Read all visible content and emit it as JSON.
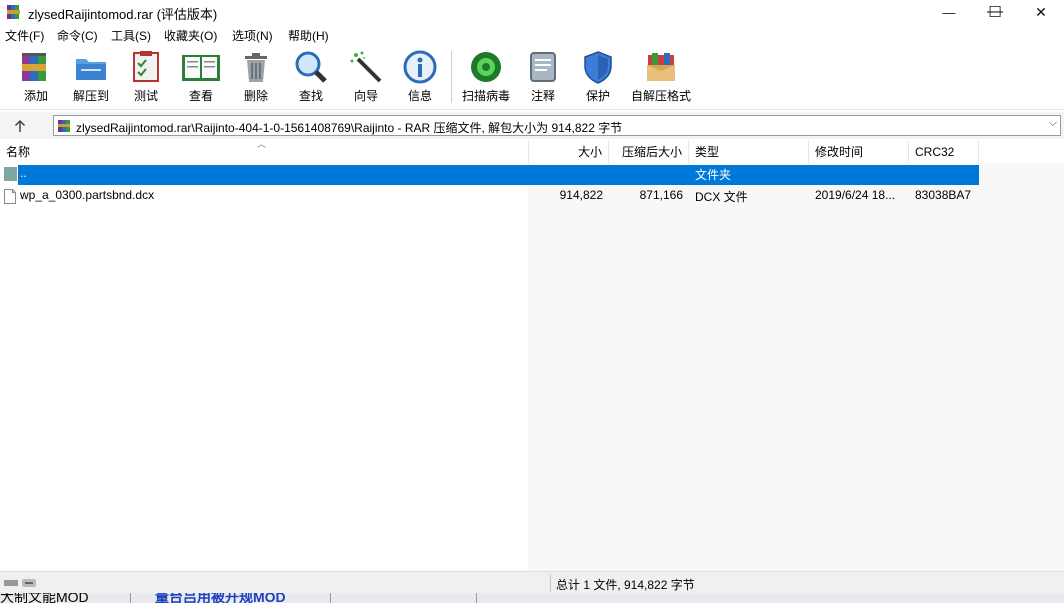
{
  "window": {
    "title": "zlysedRaijintomod.rar (评估版本)",
    "controls": {
      "minimize": "—",
      "maximize": "☐",
      "close": "✕"
    }
  },
  "menu": [
    "文件(F)",
    "命令(C)",
    "工具(S)",
    "收藏夹(O)",
    "选项(N)",
    "帮助(H)"
  ],
  "toolbar": {
    "add": "添加",
    "extract": "解压到",
    "test": "测试",
    "view": "查看",
    "delete": "删除",
    "find": "查找",
    "wizard": "向导",
    "info": "信息",
    "scan": "扫描病毒",
    "comment": "注释",
    "protect": "保护",
    "sfx": "自解压格式"
  },
  "address": {
    "path": "zlysedRaijintomod.rar\\Raijinto-404-1-0-1561408769\\Raijinto - RAR 压缩文件, 解包大小为 914,822 字节"
  },
  "columns": {
    "name": "名称",
    "size": "大小",
    "packed": "压缩后大小",
    "type": "类型",
    "modified": "修改时间",
    "crc": "CRC32"
  },
  "rows": [
    {
      "name": "..",
      "size": "",
      "packed": "",
      "type": "文件夹",
      "modified": "",
      "crc": ""
    },
    {
      "name": "wp_a_0300.partsbnd.dcx",
      "size": "914,822",
      "packed": "871,166",
      "type": "DCX 文件",
      "modified": "2019/6/24 18...",
      "crc": "83038BA7"
    }
  ],
  "status": {
    "summary": "总计 1 文件, 914,822 字节"
  },
  "taskbar": {
    "item1": "大制文能MOD",
    "item2": "量台吕用被开规MOD"
  },
  "colors": {
    "selection": "#0078d7",
    "folder_icon": "#7fa6a0"
  }
}
